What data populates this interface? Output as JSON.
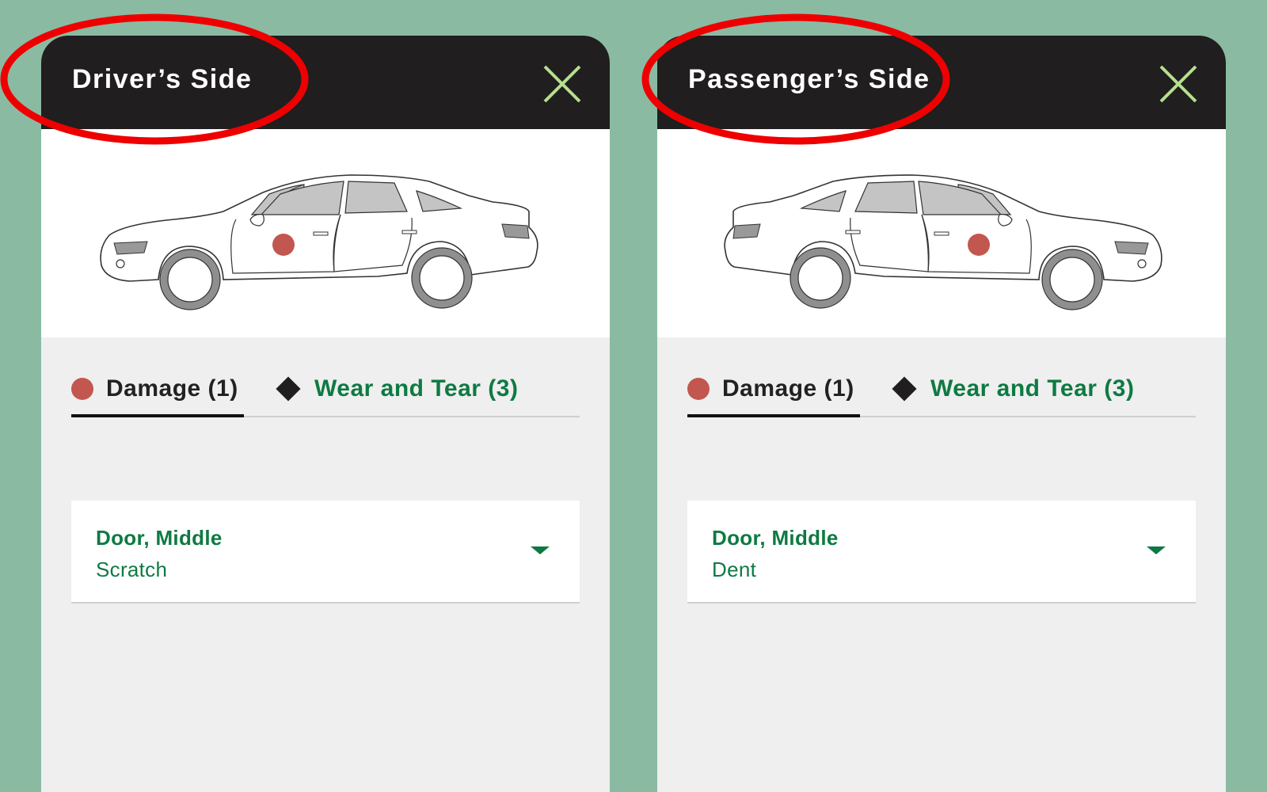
{
  "colors": {
    "background": "#8bbaa3",
    "header": "#201e1f",
    "panel": "#efefef",
    "accent_green": "#0e7a43",
    "close_icon": "#b6e08d",
    "damage_dot": "#c1574f",
    "annotation_red": "#ee0000"
  },
  "panels": [
    {
      "title": "Driver’s Side",
      "close_icon": "close-icon",
      "car_orientation": "front-left",
      "damage_marker": "damage-dot",
      "tabs": [
        {
          "label": "Damage (1)",
          "icon": "damage-dot-icon",
          "active": true
        },
        {
          "label": "Wear and Tear (3)",
          "icon": "diamond-icon",
          "active": false
        }
      ],
      "items": [
        {
          "location": "Door, Middle",
          "type": "Scratch",
          "expand_icon": "chevron-down-icon"
        }
      ]
    },
    {
      "title": "Passenger’s Side",
      "close_icon": "close-icon",
      "car_orientation": "front-right",
      "damage_marker": "damage-dot",
      "tabs": [
        {
          "label": "Damage (1)",
          "icon": "damage-dot-icon",
          "active": true
        },
        {
          "label": "Wear and Tear (3)",
          "icon": "diamond-icon",
          "active": false
        }
      ],
      "items": [
        {
          "location": "Door, Middle",
          "type": "Dent",
          "expand_icon": "chevron-down-icon"
        }
      ]
    }
  ],
  "annotations": [
    "red-ellipse-highlight",
    "red-ellipse-highlight"
  ]
}
